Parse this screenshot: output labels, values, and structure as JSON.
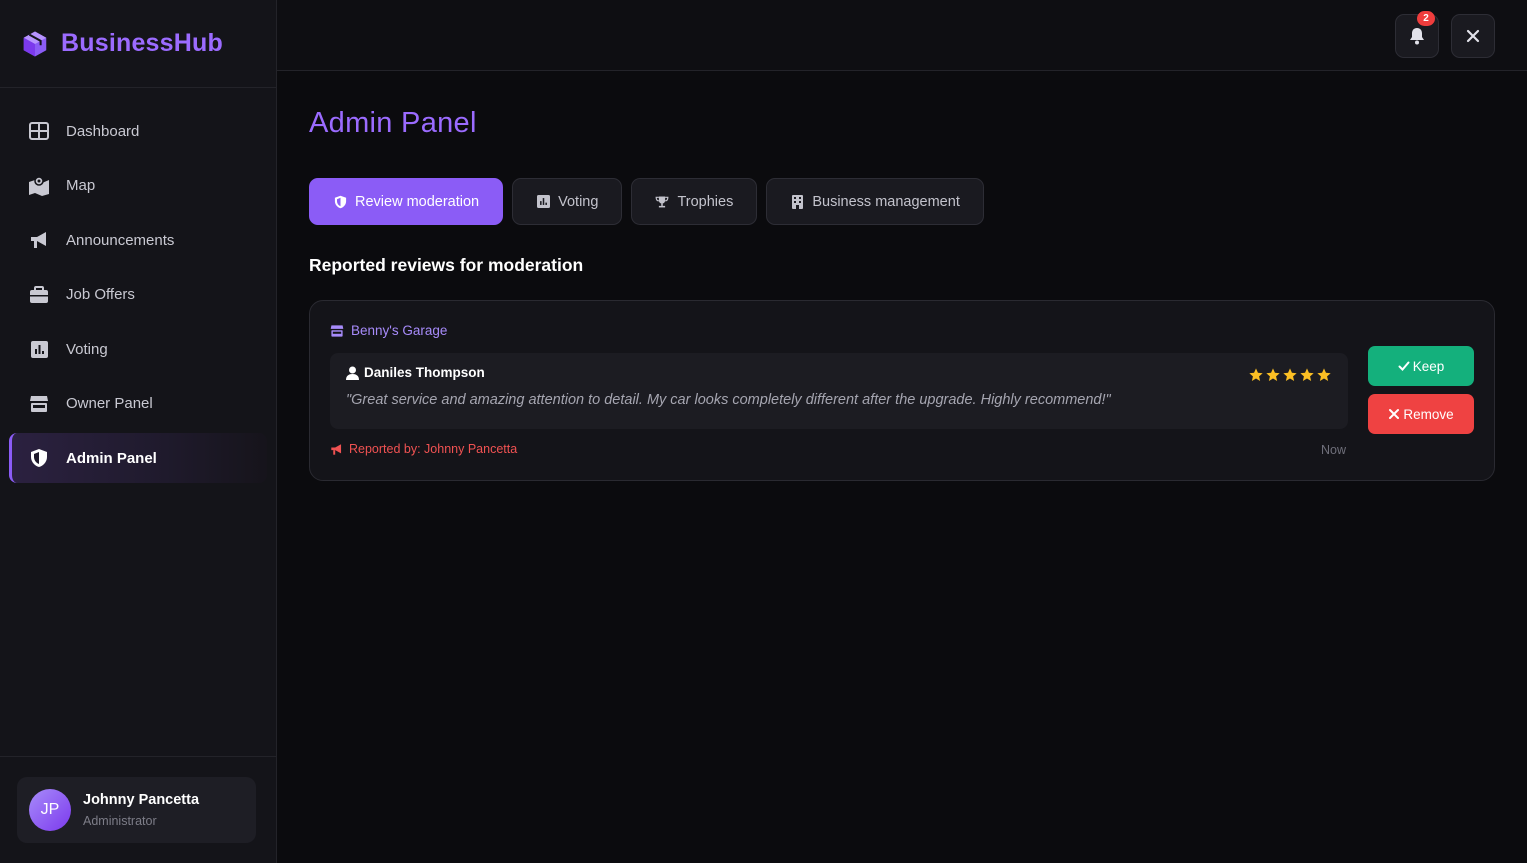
{
  "brand": {
    "name": "BusinessHub",
    "icon": "cube-icon",
    "accent": "#9b6bff"
  },
  "sidebar": {
    "items": [
      {
        "label": "Dashboard",
        "icon": "grid-icon"
      },
      {
        "label": "Map",
        "icon": "map-icon"
      },
      {
        "label": "Announcements",
        "icon": "megaphone-icon"
      },
      {
        "label": "Job Offers",
        "icon": "briefcase-icon"
      },
      {
        "label": "Voting",
        "icon": "chart-icon"
      },
      {
        "label": "Owner Panel",
        "icon": "store-icon"
      },
      {
        "label": "Admin Panel",
        "icon": "shield-icon",
        "active": true
      }
    ]
  },
  "user": {
    "initials": "JP",
    "name": "Johnny Pancetta",
    "role": "Administrator"
  },
  "topbar": {
    "notification_count": "2"
  },
  "main": {
    "title": "Admin Panel",
    "tabs": [
      {
        "label": "Review moderation",
        "icon": "shield-icon",
        "active": true
      },
      {
        "label": "Voting",
        "icon": "chart-icon"
      },
      {
        "label": "Trophies",
        "icon": "trophy-icon"
      },
      {
        "label": "Business management",
        "icon": "building-icon"
      }
    ],
    "section_title": "Reported reviews for moderation",
    "report": {
      "business": "Benny's Garage",
      "reviewer": "Daniles Thompson",
      "rating": 5,
      "review_text": "\"Great service and amazing attention to detail. My car looks completely different after the upgrade. Highly recommend!\"",
      "reported_by": "Reported by: Johnny Pancetta",
      "time": "Now",
      "keep_label": "Keep",
      "remove_label": "Remove"
    }
  },
  "colors": {
    "keep": "#14b07c",
    "remove": "#ef4242",
    "star": "#fbbf24",
    "reported": "#f05252"
  }
}
